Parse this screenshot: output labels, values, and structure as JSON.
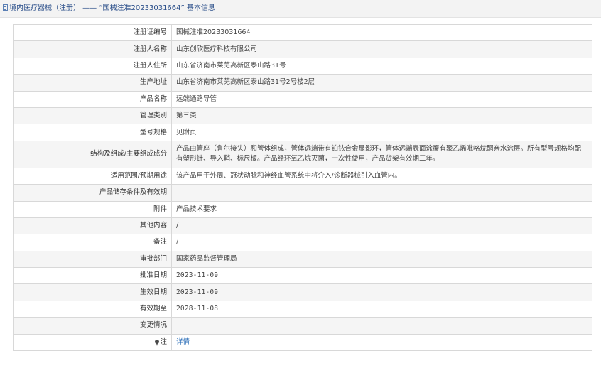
{
  "header": {
    "title": "境内医疗器械（注册） —— “国械注准20233031664” 基本信息",
    "icon": "document-icon"
  },
  "rows": {
    "reg_no": {
      "label": "注册证编号",
      "value": "国械注准20233031664"
    },
    "registrant": {
      "label": "注册人名称",
      "value": "山东创欣医疗科技有限公司"
    },
    "registrant_address": {
      "label": "注册人住所",
      "value": "山东省济南市莱芜高新区泰山路31号"
    },
    "production_address": {
      "label": "生产地址",
      "value": "山东省济南市莱芜高新区泰山路31号2号楼2层"
    },
    "product_name": {
      "label": "产品名称",
      "value": "远端通路导管"
    },
    "category": {
      "label": "管理类别",
      "value": "第三类"
    },
    "model": {
      "label": "型号规格",
      "value": "见附页"
    },
    "structure": {
      "label": "结构及组成/主要组成成分",
      "value": "产品由管座（鲁尔接头）和管体组成，管体远端带有铂铱合金显影环，管体远端表面涂覆有聚乙烯吡咯烷酮亲水涂层。所有型号规格均配有塑形针、导入鞘、标尺板。产品经环氧乙烷灭菌，一次性使用，产品货架有效期三年。"
    },
    "scope": {
      "label": "适用范围/预期用途",
      "value": "该产品用于外周、冠状动脉和神经血管系统中将介入/诊断器械引入血管内。"
    },
    "storage": {
      "label": "产品储存条件及有效期",
      "value": ""
    },
    "attachment": {
      "label": "附件",
      "value": "产品技术要求"
    },
    "other": {
      "label": "其他内容",
      "value": "/"
    },
    "remark": {
      "label": "备注",
      "value": "/"
    },
    "approval_dept": {
      "label": "审批部门",
      "value": "国家药品监督管理局"
    },
    "approval_date": {
      "label": "批准日期",
      "value": "2023-11-09"
    },
    "effective_date": {
      "label": "生效日期",
      "value": "2023-11-09"
    },
    "expiry_date": {
      "label": "有效期至",
      "value": "2028-11-08"
    },
    "change": {
      "label": "变更情况",
      "value": ""
    },
    "note": {
      "label": "注",
      "value": "详情",
      "icon": "location-pin-icon"
    }
  },
  "colors": {
    "link": "#2d6fb8",
    "header_text": "#2b4f8a",
    "border": "#d8d8d8",
    "stripe": "#f5f5f5"
  }
}
